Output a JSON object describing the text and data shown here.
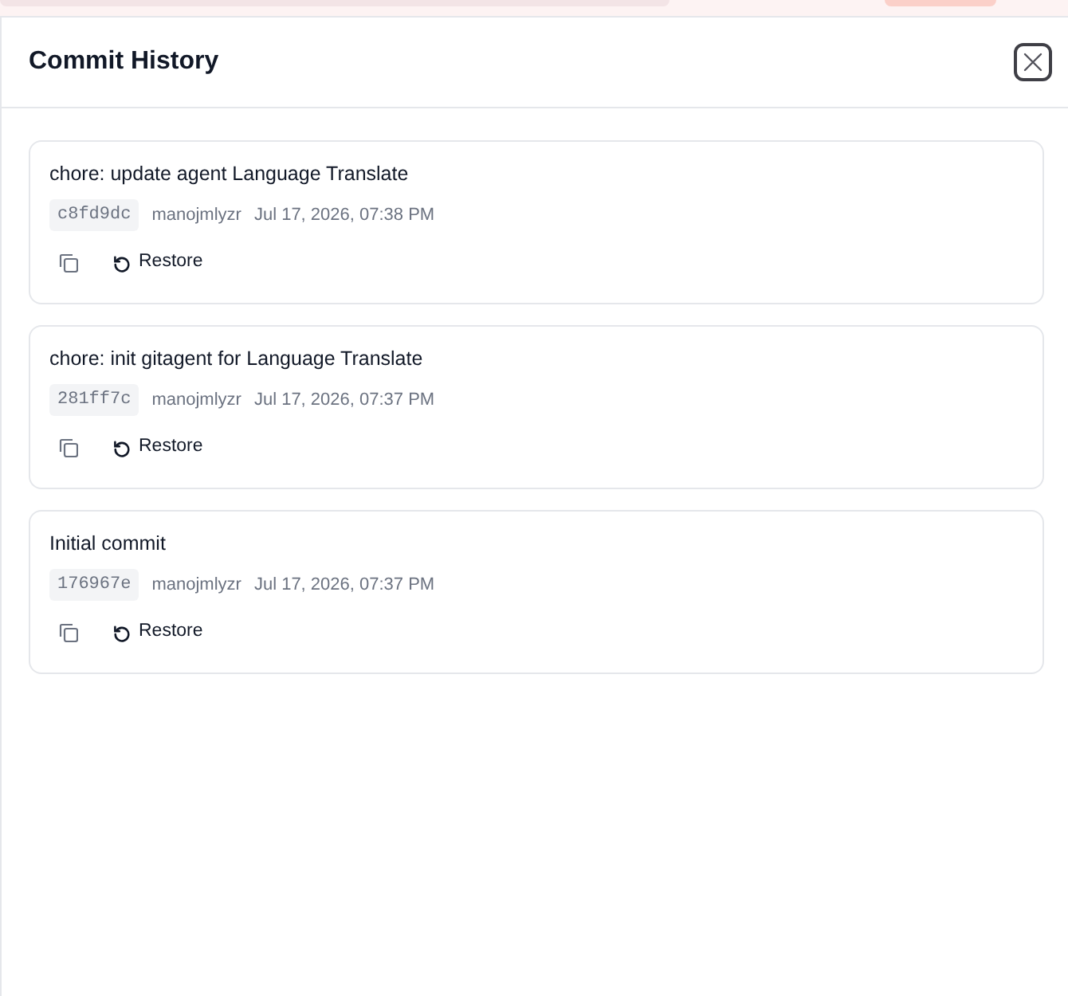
{
  "panel": {
    "title": "Commit History"
  },
  "commits": [
    {
      "message": "chore: update agent Language Translate",
      "hash": "c8fd9dc",
      "author": "manojmlyzr",
      "date": "Jul 17, 2026, 07:38 PM",
      "restore_label": "Restore"
    },
    {
      "message": "chore: init gitagent for Language Translate",
      "hash": "281ff7c",
      "author": "manojmlyzr",
      "date": "Jul 17, 2026, 07:37 PM",
      "restore_label": "Restore"
    },
    {
      "message": "Initial commit",
      "hash": "176967e",
      "author": "manojmlyzr",
      "date": "Jul 17, 2026, 07:37 PM",
      "restore_label": "Restore"
    }
  ]
}
